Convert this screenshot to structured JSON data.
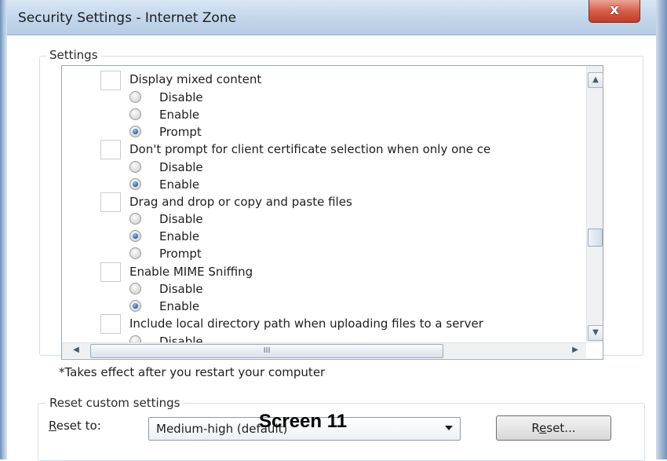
{
  "window": {
    "title": "Security Settings - Internet Zone",
    "close_glyph": "x"
  },
  "settings_group": {
    "label": "Settings",
    "entries": [
      {
        "label": "Display mixed content",
        "options": [
          "Disable",
          "Enable",
          "Prompt"
        ],
        "selected": "Prompt"
      },
      {
        "label": "Don't prompt for client certificate selection when only one ce",
        "options": [
          "Disable",
          "Enable"
        ],
        "selected": "Enable"
      },
      {
        "label": "Drag and drop or copy and paste files",
        "options": [
          "Disable",
          "Enable",
          "Prompt"
        ],
        "selected": "Enable"
      },
      {
        "label": "Enable MIME Sniffing",
        "options": [
          "Disable",
          "Enable"
        ],
        "selected": "Enable"
      },
      {
        "label": "Include local directory path when uploading files to a server",
        "options": [
          "Disable"
        ],
        "selected": ""
      }
    ],
    "hscroll_grip": "III",
    "scroll_up_glyph": "▲",
    "scroll_down_glyph": "▼",
    "scroll_left_glyph": "◀",
    "scroll_right_glyph": "▶"
  },
  "note": "*Takes effect after you restart your computer",
  "reset_group": {
    "label": "Reset custom settings",
    "reset_to_prefix": "R",
    "reset_to_rest": "eset to:",
    "dropdown_value": "Medium-high (default)",
    "button_label_prefix": "R",
    "button_label_underlined": "e",
    "button_label_rest": "set..."
  },
  "caption": "Screen 11",
  "colors": {
    "title_bar": "#c2d5ea",
    "close_button": "#d55a41",
    "radio_selected": "#1f5fa8"
  }
}
